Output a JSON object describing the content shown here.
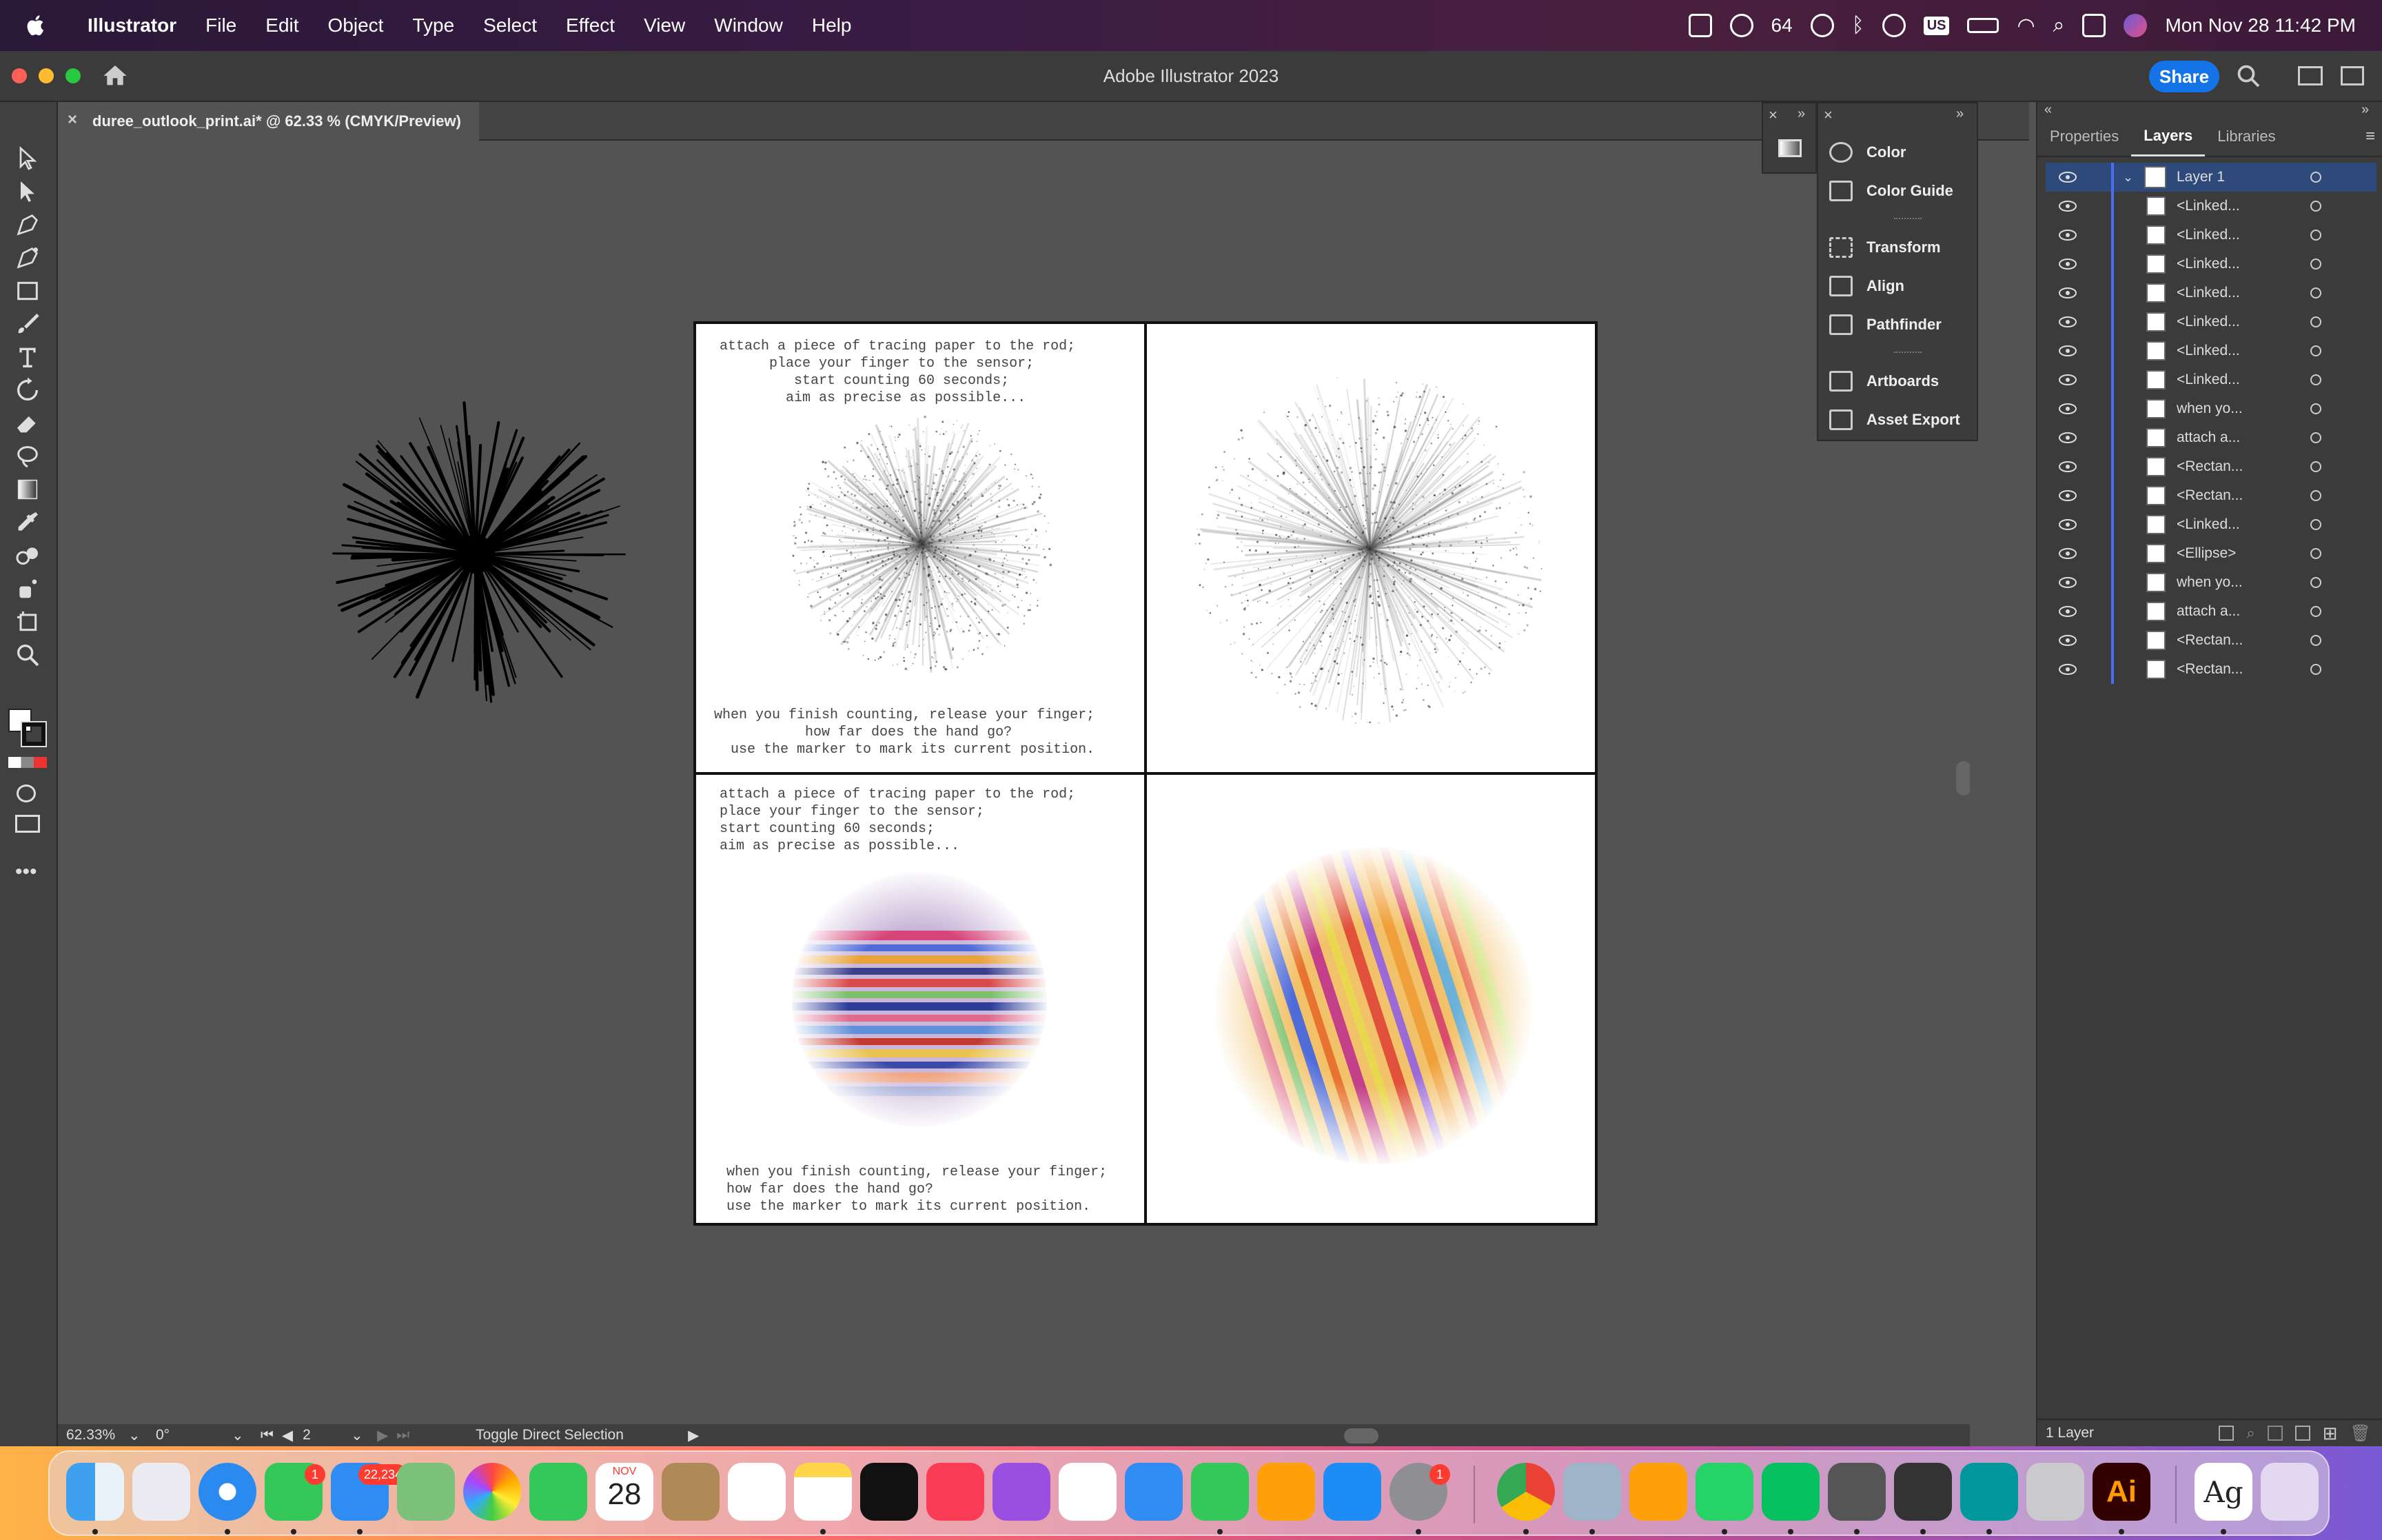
{
  "menubar": {
    "app": "Illustrator",
    "items": [
      "File",
      "Edit",
      "Object",
      "Type",
      "Select",
      "Effect",
      "View",
      "Window",
      "Help"
    ],
    "wechat_count": "64",
    "input_source": "US",
    "datetime": "Mon Nov 28  11:42 PM"
  },
  "window": {
    "title": "Adobe Illustrator 2023",
    "share": "Share"
  },
  "document": {
    "tab_label": "duree_outlook_print.ai* @ 62.33 % (CMYK/Preview)"
  },
  "artboards": {
    "top_left_text": "attach a piece of tracing paper to the rod;\n      place your finger to the sensor;\n         start counting 60 seconds;\n        aim as precise as possible...",
    "top_left_bottom_text": "when you finish counting, release your finger;\n           how far does the hand go?\n  use the marker to mark its current position.",
    "bottom_left_text": "attach a piece of tracing paper to the rod;\nplace your finger to the sensor;\nstart counting 60 seconds;\naim as precise as possible...",
    "bottom_left_bottom_text": "when you finish counting, release your finger;\nhow far does the hand go?\nuse the marker to mark its current position."
  },
  "panel_menu": {
    "items": [
      "Color",
      "Color Guide",
      "Transform",
      "Align",
      "Pathfinder",
      "Artboards",
      "Asset Export"
    ]
  },
  "right_panel": {
    "tabs": [
      "Properties",
      "Layers",
      "Libraries"
    ],
    "active_tab": "Layers",
    "layers": [
      "Layer 1",
      "<Linked...",
      "<Linked...",
      "<Linked...",
      "<Linked...",
      "<Linked...",
      "<Linked...",
      "<Linked...",
      "when yo...",
      "attach a...",
      "<Rectan...",
      "<Rectan...",
      "<Linked...",
      "<Ellipse>",
      "when yo...",
      "attach a...",
      "<Rectan...",
      "<Rectan..."
    ],
    "footer": "1 Layer"
  },
  "statusbar": {
    "zoom": "62.33%",
    "rotation": "0°",
    "artboard_num": "2",
    "tool_hint": "Toggle Direct Selection"
  },
  "dock": {
    "messages_badge": "1",
    "mail_badge": "22,234",
    "calendar_month": "NOV",
    "calendar_day": "28",
    "settings_badge": "1",
    "illustrator_label": "Ai",
    "dictionary_label": "Ag"
  },
  "colors": {
    "accent": "#1473e6",
    "layer_bar": "#4c6ef5",
    "panel_bg": "#3b3b3b",
    "canvas_bg": "#535353"
  }
}
